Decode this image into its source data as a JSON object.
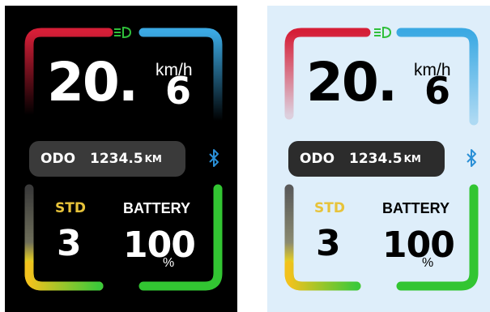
{
  "displays": [
    {
      "theme": "dark",
      "speed_integer": "20.",
      "speed_decimal": "6",
      "speed_unit": "km/h",
      "odo_label": "ODO",
      "odo_value": "1234.5",
      "odo_unit": "KM",
      "mode_label": "STD",
      "assist_level": "3",
      "battery_label": "BATTERY",
      "battery_value": "100",
      "battery_unit": "%",
      "battery_level": 1.0,
      "headlight_on": true,
      "bluetooth_connected": true
    },
    {
      "theme": "light",
      "speed_integer": "20.",
      "speed_decimal": "6",
      "speed_unit": "km/h",
      "odo_label": "ODO",
      "odo_value": "1234.5",
      "odo_unit": "KM",
      "mode_label": "STD",
      "assist_level": "3",
      "battery_label": "BATTERY",
      "battery_value": "100",
      "battery_unit": "%",
      "battery_level": 1.0,
      "headlight_on": true,
      "bluetooth_connected": true
    }
  ],
  "colors": {
    "dark_background": "#000000",
    "light_background": "#deeefa",
    "speed_arc_left": "#d51e37",
    "speed_arc_right": "#3ba9e3",
    "battery_arc": "#32c532",
    "mode_label": "#e7c33a",
    "headlight": "#2fbf3a",
    "bluetooth": "#2a8fd6",
    "odo_box_dark": "#3a3a3a",
    "odo_box_light": "#2c2c2c"
  },
  "icons": [
    "headlight-icon",
    "bluetooth-icon"
  ]
}
